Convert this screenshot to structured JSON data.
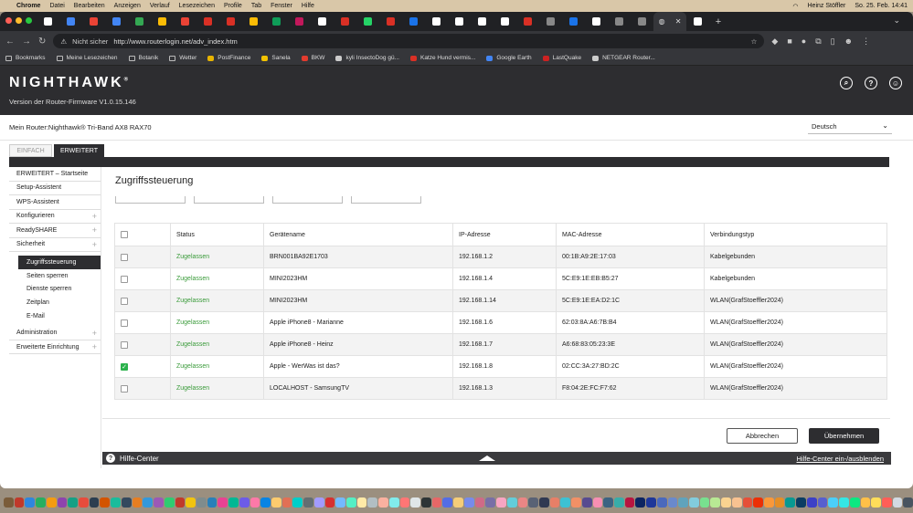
{
  "macos": {
    "menu": [
      "Chrome",
      "Datei",
      "Bearbeiten",
      "Anzeigen",
      "Verlauf",
      "Lesezeichen",
      "Profile",
      "Tab",
      "Fenster",
      "Hilfe"
    ],
    "user": "Heinz Stöffler",
    "clock": "So. 25. Feb.  14:41"
  },
  "browser": {
    "secure_label": "Nicht sicher",
    "url": "http://www.routerlogin.net/adv_index.htm",
    "bookmarks": [
      "Bookmarks",
      "Meine Lesezeichen",
      "Botanik",
      "Wetter",
      "PostFinance",
      "Sanela",
      "BKW",
      "kyli InsectoDog gü...",
      "Katze Hund vermis...",
      "Google Earth",
      "LastQuake",
      "NETGEAR Router..."
    ],
    "bookmark_colors": [
      "#9aa0a6",
      "#9aa0a6",
      "#9aa0a6",
      "#9aa0a6",
      "#e8b400",
      "#f2c200",
      "#e23b2e",
      "#cccccc",
      "#d93025",
      "#4285f4",
      "#cc2222",
      "#cccccc"
    ]
  },
  "header": {
    "logo": "NIGHTHAWK",
    "firmware": "Version der Router-Firmware V1.0.15.146"
  },
  "router": {
    "name": "Mein Router:Nighthawk® Tri-Band AX8 RAX70",
    "language": "Deutsch"
  },
  "modes": {
    "simple": "EINFACH",
    "advanced": "ERWEITERT"
  },
  "sidebar": {
    "items_top": [
      {
        "label": "ERWEITERT – Startseite",
        "plus": false
      },
      {
        "label": "Setup-Assistent",
        "plus": false
      },
      {
        "label": "WPS-Assistent",
        "plus": false
      },
      {
        "label": "Konfigurieren",
        "plus": true
      },
      {
        "label": "ReadySHARE",
        "plus": true
      },
      {
        "label": "Sicherheit",
        "plus": true
      }
    ],
    "sub_items": [
      "Zugriffssteuerung",
      "Seiten sperren",
      "Dienste sperren",
      "Zeitplan",
      "E-Mail"
    ],
    "items_bottom": [
      {
        "label": "Administration",
        "plus": true
      },
      {
        "label": "Erweiterte Einrichtung",
        "plus": true
      }
    ]
  },
  "page": {
    "title": "Zugriffssteuerung",
    "columns": [
      "Status",
      "Gerätename",
      "IP-Adresse",
      "MAC-Adresse",
      "Verbindungstyp"
    ],
    "rows": [
      {
        "checked": false,
        "status": "Zugelassen",
        "name": "BRN001BA92E1703",
        "ip": "192.168.1.2",
        "mac": "00:1B:A9:2E:17:03",
        "type": "Kabelgebunden"
      },
      {
        "checked": false,
        "status": "Zugelassen",
        "name": "MINI2023HM",
        "ip": "192.168.1.4",
        "mac": "5C:E9:1E:EB:B5:27",
        "type": "Kabelgebunden"
      },
      {
        "checked": false,
        "status": "Zugelassen",
        "name": "MINI2023HM",
        "ip": "192.168.1.14",
        "mac": "5C:E9:1E:EA:D2:1C",
        "type": "WLAN(GrafStoeffler2024)"
      },
      {
        "checked": false,
        "status": "Zugelassen",
        "name": "Apple iPhone8 - Marianne",
        "ip": "192.168.1.6",
        "mac": "62:03:8A:A6:7B:B4",
        "type": "WLAN(GrafStoeffler2024)"
      },
      {
        "checked": false,
        "status": "Zugelassen",
        "name": "Apple iPhone8 - Heinz",
        "ip": "192.168.1.7",
        "mac": "A6:68:83:05:23:3E",
        "type": "WLAN(GrafStoeffler2024)"
      },
      {
        "checked": true,
        "status": "Zugelassen",
        "name": "Apple - WerWas ist das?",
        "ip": "192.168.1.8",
        "mac": "02:CC:3A:27:BD:2C",
        "type": "WLAN(GrafStoeffler2024)"
      },
      {
        "checked": false,
        "status": "Zugelassen",
        "name": "LOCALHOST - SamsungTV",
        "ip": "192.168.1.3",
        "mac": "F8:04:2E:FC:F7:62",
        "type": "WLAN(GrafStoeffler2024)"
      }
    ],
    "cancel": "Abbrechen",
    "apply": "Übernehmen"
  },
  "help": {
    "label": "Hilfe-Center",
    "toggle": "Hilfe-Center ein-/ausblenden"
  },
  "colors": {
    "brand_dark": "#2d2d30",
    "allowed_green": "#3a9b3a",
    "checkbox_green": "#2bb24c"
  }
}
